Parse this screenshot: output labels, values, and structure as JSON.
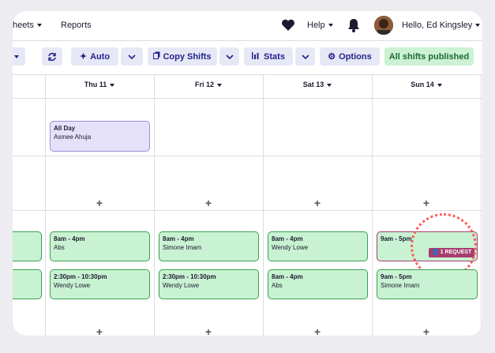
{
  "nav": {
    "timesheets_label": "heets",
    "reports_label": "Reports",
    "help_label": "Help",
    "user_greeting": "Hello, Ed Kingsley"
  },
  "toolbar": {
    "auto_label": "Auto",
    "copy_shifts_label": "Copy Shifts",
    "stats_label": "Stats",
    "options_label": "Options",
    "published_label": "All shifts published"
  },
  "days": [
    "Thu 11",
    "Fri 12",
    "Sat 13",
    "Sun 14"
  ],
  "allday": {
    "title": "All Day",
    "name": "Asmee Ahuja"
  },
  "row1": [
    {
      "time": "8am - 4pm",
      "name": "Abs"
    },
    {
      "time": "8am - 4pm",
      "name": "Simone Imam"
    },
    {
      "time": "8am - 4pm",
      "name": "Wendy Lowe"
    },
    {
      "time": "9am - 5pm",
      "name": ""
    }
  ],
  "row2": [
    {
      "time": "2:30pm - 10:30pm",
      "name": "Wendy Lowe"
    },
    {
      "time": "2:30pm - 10:30pm",
      "name": "Wendy Lowe"
    },
    {
      "time": "8am - 4pm",
      "name": "Abs"
    },
    {
      "time": "9am - 5pm",
      "name": "Simone Imam"
    }
  ],
  "request_badge": "1 REQUEST",
  "colors": {
    "accent": "#24238a",
    "shift_green": "#c9f2d2",
    "request": "#a63d6f",
    "highlight": "#ff5a5a"
  }
}
